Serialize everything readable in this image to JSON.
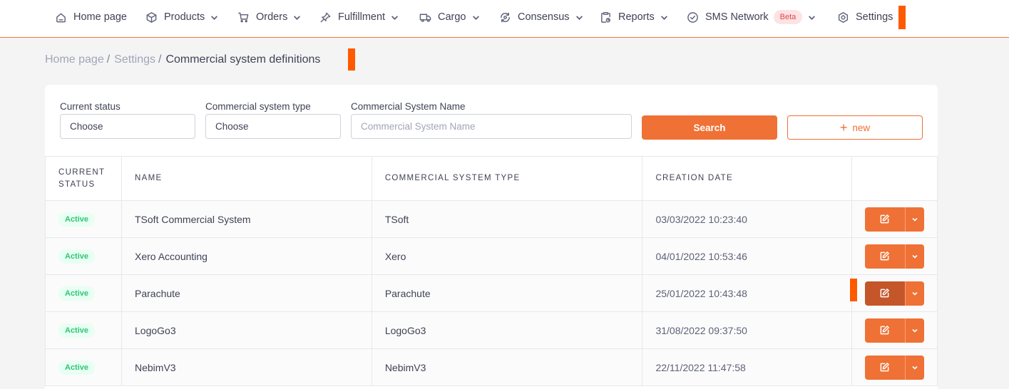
{
  "nav": [
    {
      "label": "Home page",
      "icon": "home-icon",
      "has_chevron": false
    },
    {
      "label": "Products",
      "icon": "box-icon",
      "has_chevron": true
    },
    {
      "label": "Orders",
      "icon": "cart-icon",
      "has_chevron": true
    },
    {
      "label": "Fulfillment",
      "icon": "pin-icon",
      "has_chevron": true
    },
    {
      "label": "Cargo",
      "icon": "truck-icon",
      "has_chevron": true
    },
    {
      "label": "Consensus",
      "icon": "sync-icon",
      "has_chevron": true
    },
    {
      "label": "Reports",
      "icon": "report-icon",
      "has_chevron": true
    },
    {
      "label": "SMS Network",
      "icon": "check-circle-icon",
      "has_chevron": true,
      "badge": "Beta"
    },
    {
      "label": "Settings",
      "icon": "gear-icon",
      "has_chevron": false
    }
  ],
  "breadcrumb": {
    "items": [
      "Home page",
      "Settings"
    ],
    "separator": "/",
    "current": "Commercial system definitions"
  },
  "filters": {
    "status": {
      "label": "Current status",
      "value": "Choose"
    },
    "type": {
      "label": "Commercial system type",
      "value": "Choose"
    },
    "name": {
      "label": "Commercial System Name",
      "placeholder": "Commercial System Name"
    },
    "search_label": "Search",
    "new_label": "new"
  },
  "table": {
    "headers": {
      "status": "CURRENT STATUS",
      "name": "NAME",
      "type": "COMMERCIAL SYSTEM TYPE",
      "date": "CREATION DATE"
    },
    "rows": [
      {
        "status": "Active",
        "name": "TSoft Commercial System",
        "type": "TSoft",
        "date": "03/03/2022 10:23:40"
      },
      {
        "status": "Active",
        "name": "Xero Accounting",
        "type": "Xero",
        "date": "04/01/2022 10:53:46"
      },
      {
        "status": "Active",
        "name": "Parachute",
        "type": "Parachute",
        "date": "25/01/2022 10:43:48"
      },
      {
        "status": "Active",
        "name": "LogoGo3",
        "type": "LogoGo3",
        "date": "31/08/2022 09:37:50"
      },
      {
        "status": "Active",
        "name": "NebimV3",
        "type": "NebimV3",
        "date": "22/11/2022 11:47:58"
      }
    ]
  },
  "colors": {
    "accent": "#ef7135",
    "accent_pressed": "#c4562a",
    "marker": "#ff5a00",
    "active_badge_bg": "#e8fff3",
    "active_badge_text": "#2fc575",
    "beta_bg": "#fde3e3",
    "beta_text": "#e0474c"
  }
}
